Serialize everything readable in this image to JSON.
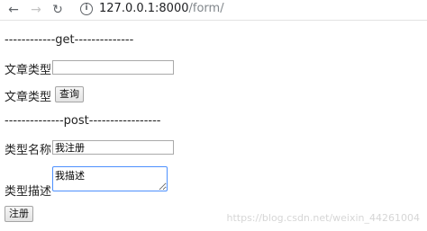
{
  "browser": {
    "url_host": "127.0.0.1:8000",
    "url_path": "/form/",
    "back_icon": "←",
    "forward_icon": "→",
    "reload_icon": "↻",
    "info_icon": "i"
  },
  "form_get": {
    "divider": "------------get--------------",
    "type_label": "文章类型",
    "type_value": "",
    "query_label": "文章类型",
    "query_button": "查询"
  },
  "form_post": {
    "divider": "--------------post-----------------",
    "name_label": "类型名称",
    "name_value": "我注册",
    "desc_label": "类型描述",
    "desc_value": "我描述",
    "submit_button": "注册"
  },
  "watermark": "https://blog.csdn.net/weixin_44261004"
}
